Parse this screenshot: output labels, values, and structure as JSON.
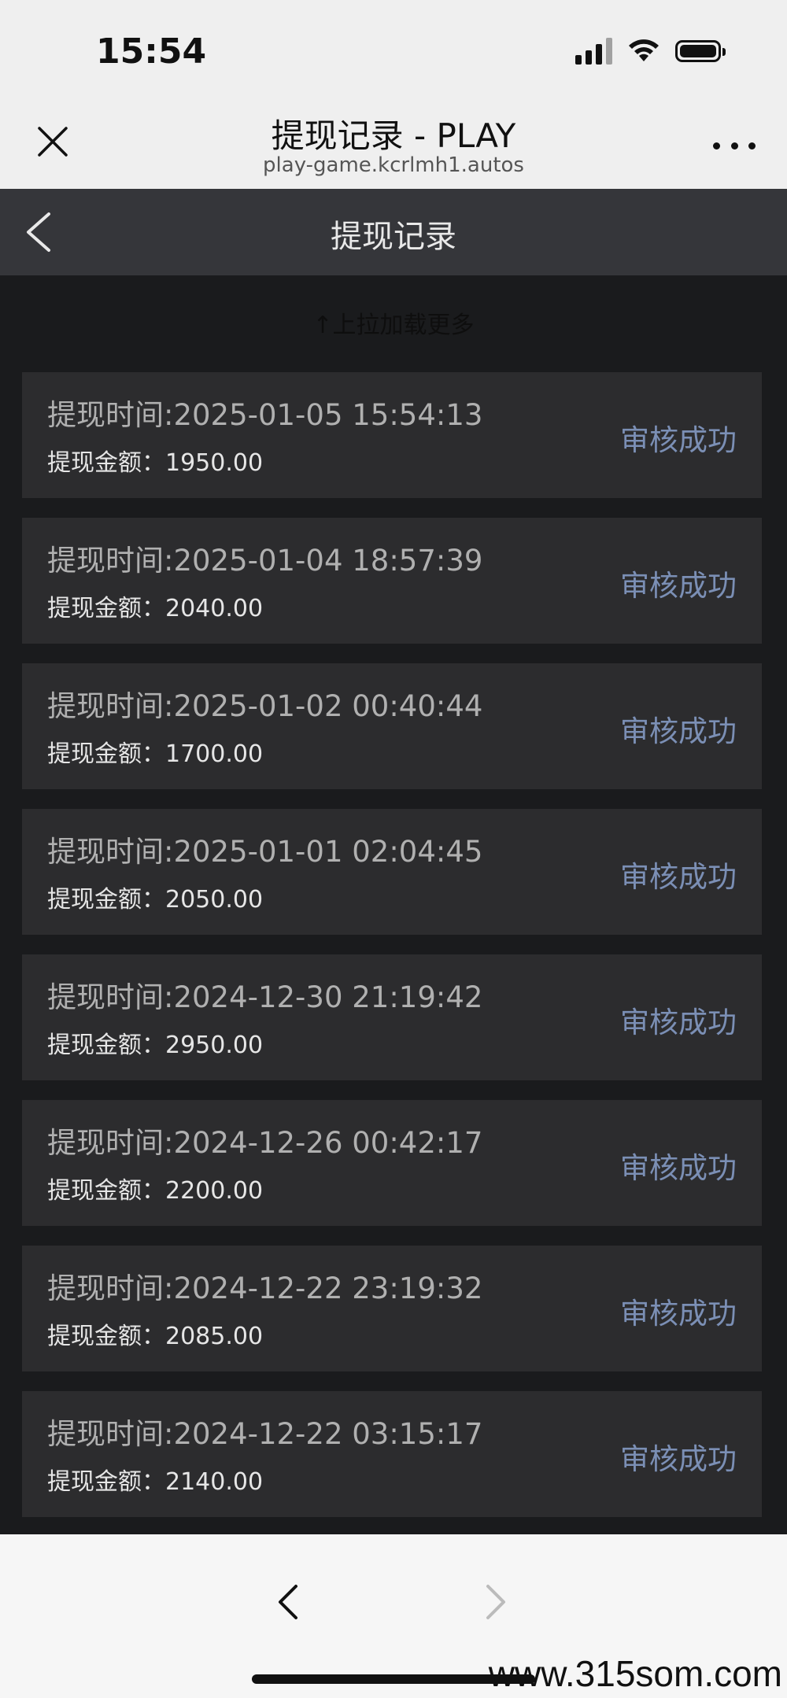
{
  "status_bar": {
    "time": "15:54"
  },
  "browser": {
    "title": "提现记录 - PLAY",
    "url": "play-game.kcrlmh1.autos"
  },
  "app_nav": {
    "title": "提现记录"
  },
  "list": {
    "pull_hint": "↑上拉加载更多",
    "records": [
      {
        "time": "提现时间:2025-01-05 15:54:13",
        "amount_label": "提现金额：",
        "amount": "1950.00",
        "status": "审核成功"
      },
      {
        "time": "提现时间:2025-01-04 18:57:39",
        "amount_label": "提现金额：",
        "amount": "2040.00",
        "status": "审核成功"
      },
      {
        "time": "提现时间:2025-01-02 00:40:44",
        "amount_label": "提现金额：",
        "amount": "1700.00",
        "status": "审核成功"
      },
      {
        "time": "提现时间:2025-01-01 02:04:45",
        "amount_label": "提现金额：",
        "amount": "2050.00",
        "status": "审核成功"
      },
      {
        "time": "提现时间:2024-12-30 21:19:42",
        "amount_label": "提现金额：",
        "amount": "2950.00",
        "status": "审核成功"
      },
      {
        "time": "提现时间:2024-12-26 00:42:17",
        "amount_label": "提现金额：",
        "amount": "2200.00",
        "status": "审核成功"
      },
      {
        "time": "提现时间:2024-12-22 23:19:32",
        "amount_label": "提现金额：",
        "amount": "2085.00",
        "status": "审核成功"
      },
      {
        "time": "提现时间:2024-12-22 03:15:17",
        "amount_label": "提现金额：",
        "amount": "2140.00",
        "status": "审核成功"
      }
    ]
  },
  "watermark": "www.315som.com",
  "colors": {
    "background": "#1a1b1d",
    "card": "#2c2c2e",
    "nav": "#35363a",
    "status_text": "#7b8fb5",
    "browser_chrome": "#efefef"
  },
  "icons": {
    "close": "close-icon",
    "more": "more-icon",
    "back": "chevron-left-icon",
    "browser_back": "chevron-left-icon",
    "browser_forward": "chevron-right-icon",
    "signal": "signal-icon",
    "wifi": "wifi-icon",
    "battery": "battery-icon"
  }
}
